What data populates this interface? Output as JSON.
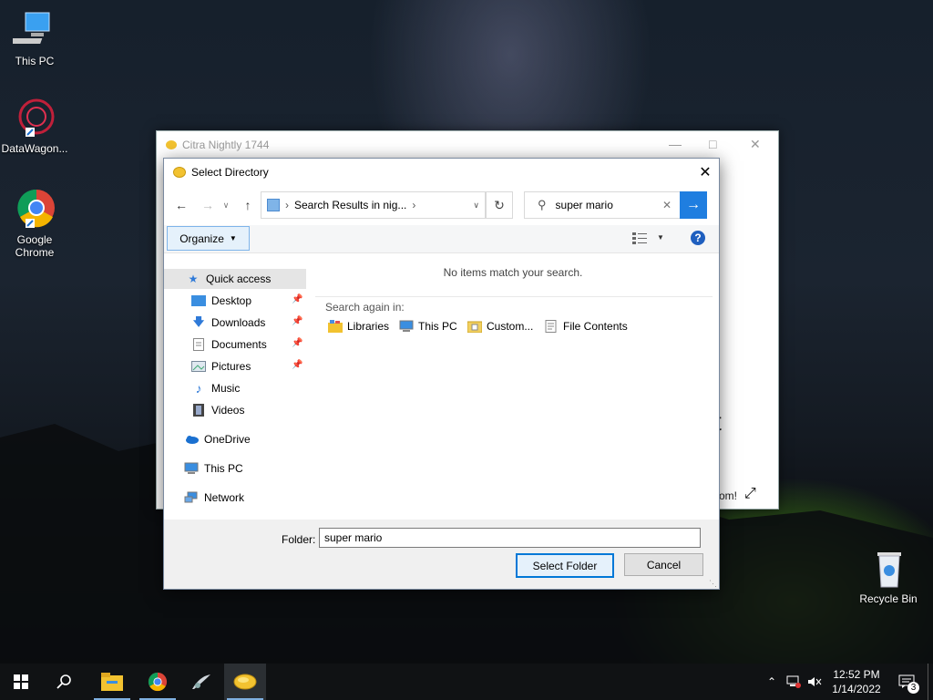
{
  "desktop": {
    "icons": [
      {
        "label": "This PC"
      },
      {
        "label": "DataWagon..."
      },
      {
        "label": "Google Chrome"
      },
      {
        "label": "Recycle Bin"
      }
    ]
  },
  "background_window": {
    "title": "Citra Nightly 1744",
    "big_text": "t",
    "zoom_text": "om!"
  },
  "dialog": {
    "title": "Select Directory",
    "address": {
      "path": "Search Results in nig..."
    },
    "search": {
      "value": "super mario"
    },
    "toolbar": {
      "organize_label": "Organize"
    },
    "nav": {
      "quick_access": "Quick access",
      "desktop": "Desktop",
      "downloads": "Downloads",
      "documents": "Documents",
      "pictures": "Pictures",
      "music": "Music",
      "videos": "Videos",
      "onedrive": "OneDrive",
      "this_pc": "This PC",
      "network": "Network"
    },
    "content": {
      "no_items": "No items match your search.",
      "search_again": "Search again in:",
      "locations": [
        "Libraries",
        "This PC",
        "Custom...",
        "File Contents"
      ]
    },
    "folder_label": "Folder:",
    "folder_value": "super mario",
    "select_button": "Select Folder",
    "cancel_button": "Cancel"
  },
  "taskbar": {
    "time": "12:52 PM",
    "date": "1/14/2022",
    "notification_count": "3"
  },
  "colors": {
    "accent": "#0078d7",
    "search_go": "#1f7ee0",
    "selection": "#cce4f7"
  }
}
